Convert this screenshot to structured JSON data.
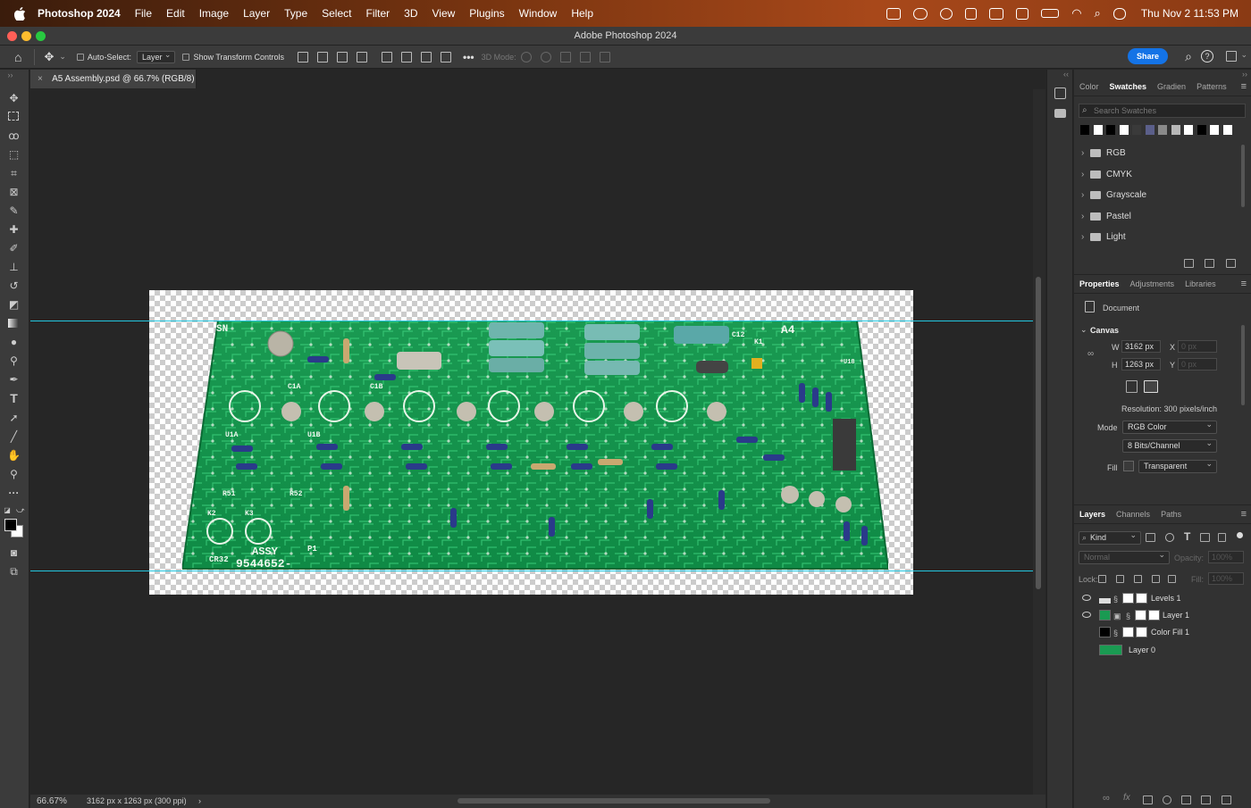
{
  "menubar": {
    "app_name": "Photoshop 2024",
    "menus": [
      "File",
      "Edit",
      "Image",
      "Layer",
      "Type",
      "Select",
      "Filter",
      "3D",
      "View",
      "Plugins",
      "Window",
      "Help"
    ],
    "clock": "Thu Nov 2  11:53 PM"
  },
  "window": {
    "title": "Adobe Photoshop 2024"
  },
  "options": {
    "auto_select_label": "Auto-Select:",
    "auto_select_value": "Layer",
    "show_transform_label": "Show Transform Controls",
    "mode_3d_label": "3D Mode:",
    "share_label": "Share"
  },
  "document": {
    "tab_title": "A5 Assembly.psd @ 66.7% (RGB/8)",
    "zoom": "66.67%",
    "info": "3162 px x 1263 px (300 ppi)",
    "board_labels": {
      "sn": "SN",
      "a4": "A4",
      "assy": "ASSY",
      "number": "9544652-",
      "p1": "P1",
      "cr32": "CR32",
      "k2": "K2",
      "k3": "K3",
      "u1a": "U1A",
      "u1b": "U1B",
      "r51": "R51",
      "r52": "R52",
      "c1a": "C1A",
      "c1b": "C1B",
      "c12": "C12",
      "k1": "K1",
      "u18": "U18"
    }
  },
  "swatches_panel": {
    "tabs": [
      "Color",
      "Swatches",
      "Gradien",
      "Patterns"
    ],
    "active_tab": "Swatches",
    "search_placeholder": "Search Swatches",
    "colors": [
      "#000000",
      "#ffffff",
      "#000000",
      "#ffffff",
      "#3a3a3a",
      "#5b5f8a",
      "#8a8a8a",
      "#b8b8b8",
      "#ffffff",
      "#000000",
      "#ffffff",
      "#ffffff"
    ],
    "groups": [
      "RGB",
      "CMYK",
      "Grayscale",
      "Pastel",
      "Light"
    ]
  },
  "properties_panel": {
    "tabs": [
      "Properties",
      "Adjustments",
      "Libraries"
    ],
    "active_tab": "Properties",
    "doc_label": "Document",
    "canvas_label": "Canvas",
    "w_label": "W",
    "w_value": "3162 px",
    "h_label": "H",
    "h_value": "1263 px",
    "x_label": "X",
    "x_value": "0 px",
    "y_label": "Y",
    "y_value": "0 px",
    "resolution": "Resolution: 300 pixels/inch",
    "mode_label": "Mode",
    "mode_value": "RGB Color",
    "bits_value": "8 Bits/Channel",
    "fill_label": "Fill",
    "fill_value": "Transparent"
  },
  "layers_panel": {
    "tabs": [
      "Layers",
      "Channels",
      "Paths"
    ],
    "active_tab": "Layers",
    "kind_label": "Kind",
    "blend_mode": "Normal",
    "opacity_label": "Opacity:",
    "opacity_value": "100%",
    "lock_label": "Lock:",
    "fill_label": "Fill:",
    "fill_value": "100%",
    "layers": [
      {
        "name": "Levels 1",
        "visible": true
      },
      {
        "name": "Layer 1",
        "visible": true
      },
      {
        "name": "Color Fill 1",
        "visible": false
      },
      {
        "name": "Layer 0",
        "visible": false
      }
    ]
  }
}
